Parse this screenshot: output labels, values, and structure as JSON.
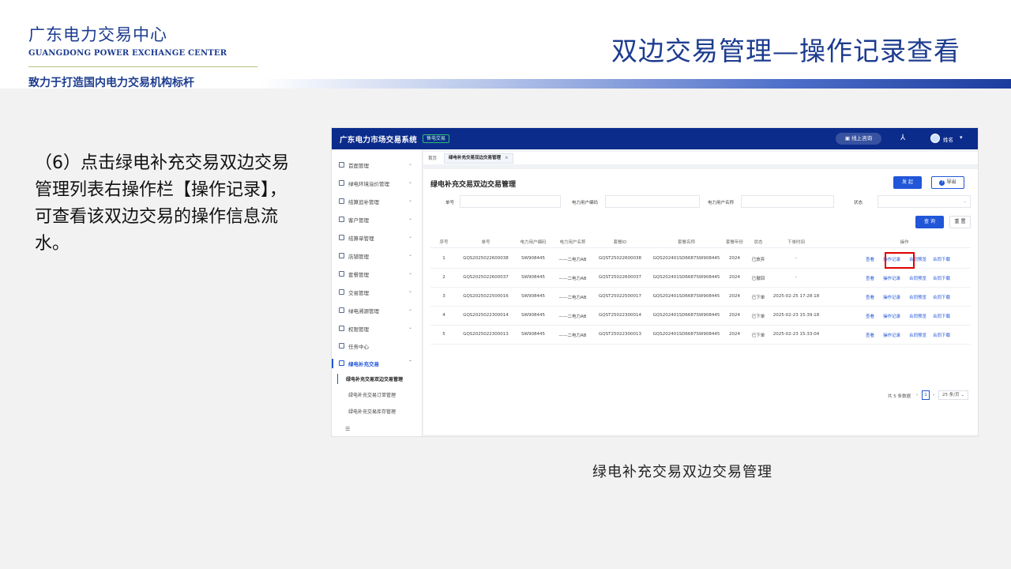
{
  "header": {
    "org_name": "广东电力交易中心",
    "org_name_en": "GUANGDONG POWER EXCHANGE CENTER",
    "slogan": "致力于打造国内电力交易机构标杆",
    "title": "双边交易管理—操作记录查看"
  },
  "description": "（6）点击绿电补充交易双边交易管理列表右操作栏【操作记录】，可查看该双边交易的操作信息流水。",
  "caption": "绿电补充交易双边交易管理",
  "app": {
    "title": "广东电力市场交易系统",
    "badge": "售电交易",
    "online_query": "线上咨询",
    "user": "姓名",
    "sidebar": {
      "items": [
        {
          "label": "首面管理",
          "caret": "⌄"
        },
        {
          "label": "绿电环境溢价管理",
          "caret": "⌄"
        },
        {
          "label": "结算追补管理",
          "caret": "⌄"
        },
        {
          "label": "客户管理",
          "caret": "⌄"
        },
        {
          "label": "结算单管理",
          "caret": "⌄"
        },
        {
          "label": "店铺管理",
          "caret": "⌄"
        },
        {
          "label": "套餐管理",
          "caret": "⌄"
        },
        {
          "label": "交易管理",
          "caret": "⌄"
        },
        {
          "label": "绿电溯源管理",
          "caret": "⌄"
        },
        {
          "label": "权限管理",
          "caret": "⌄"
        },
        {
          "label": "任务中心",
          "caret": ""
        },
        {
          "label": "绿电补充交易",
          "caret": "⌃"
        }
      ],
      "sub_items": [
        {
          "label": "绿电补充交易双边交易管理"
        },
        {
          "label": "绿电补充交易订单管理"
        },
        {
          "label": "绿电补充交易库存管理"
        }
      ],
      "collapse": "☰"
    },
    "tabs": {
      "home": "首页",
      "active": "绿电补充交易双边交易管理",
      "close": "×"
    },
    "panel": {
      "title": "绿电补充交易双边交易管理",
      "initiate_btn": "发 起",
      "export_btn": "导出",
      "query_btn": "查 询",
      "reset_btn": "重 置",
      "filters": [
        {
          "label": "单号",
          "placeholder": ""
        },
        {
          "label": "电力用户编码",
          "placeholder": ""
        },
        {
          "label": "电力用户名称",
          "placeholder": ""
        },
        {
          "label": "状态",
          "placeholder": ""
        }
      ]
    },
    "table": {
      "columns": [
        "序号",
        "单号",
        "电力用户编码",
        "电力用户名称",
        "套餐ID",
        "套餐名称",
        "套餐年份",
        "状态",
        "下单时间",
        "操作"
      ],
      "rows": [
        {
          "no": "1",
          "order": "GQS2025022600038",
          "code": "SW908445",
          "name": "——二电力AB",
          "pkg_id": "GQST25022600038",
          "pkg_name": "GQS202401SD6687SW908445",
          "year": "2024",
          "status": "已放弃",
          "time": "-"
        },
        {
          "no": "2",
          "order": "GQS2025022600037",
          "code": "SW908445",
          "name": "——二电力AB",
          "pkg_id": "GQST25022600037",
          "pkg_name": "GQS202401SD6687SW908445",
          "year": "2024",
          "status": "已撤回",
          "time": "-"
        },
        {
          "no": "3",
          "order": "GQS2025022500016",
          "code": "SW908445",
          "name": "——二电力AB",
          "pkg_id": "GQST25022500017",
          "pkg_name": "GQS202401SD6687SW908445",
          "year": "2024",
          "status": "已下单",
          "time": "2025-02-25 17:28:18"
        },
        {
          "no": "4",
          "order": "GQS2025022300014",
          "code": "SW908445",
          "name": "——二电力AB",
          "pkg_id": "GQST25022300014",
          "pkg_name": "GQS202401SD6687SW908445",
          "year": "2024",
          "status": "已下单",
          "time": "2025-02-23 15:39:18"
        },
        {
          "no": "5",
          "order": "GQS2025022300013",
          "code": "SW908445",
          "name": "——二电力AB",
          "pkg_id": "GQST25022300013",
          "pkg_name": "GQS202401SD6687SW908445",
          "year": "2024",
          "status": "已下单",
          "time": "2025-02-23 15:33:04"
        }
      ],
      "ops": [
        "查看",
        "操作记录",
        "合同预览",
        "合同下载"
      ]
    },
    "pagination": {
      "total": "共 5 条数据",
      "prev": "‹",
      "current": "1",
      "next": "›",
      "page_size": "25 条/页"
    }
  }
}
